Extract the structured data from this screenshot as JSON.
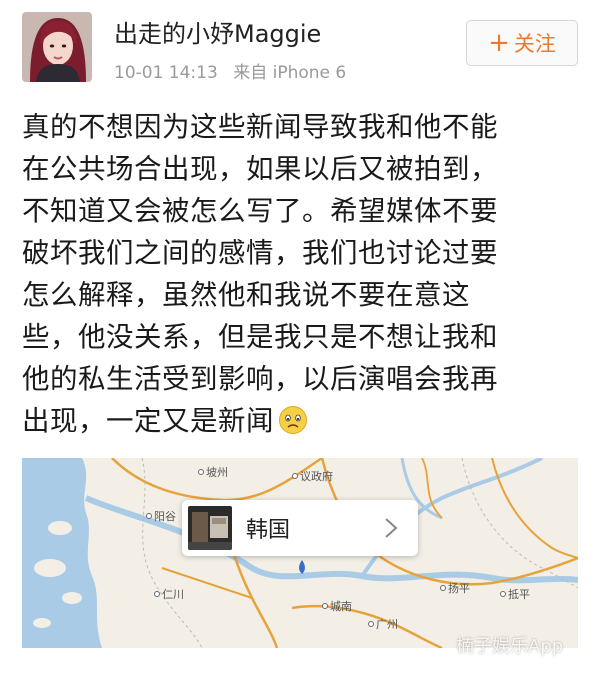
{
  "user": {
    "name": "出走的小妤Maggie",
    "time": "10-01 14:13",
    "source": "来自 iPhone 6"
  },
  "follow": {
    "icon": "plus-icon",
    "label": "关注"
  },
  "post": {
    "lines": [
      "真的不想因为这些新闻导致我和他不能",
      "在公共场合出现，如果以后又被拍到，",
      "不知道又会被怎么写了。希望媒体不要",
      "破坏我们之间的感情，我们也讨论过要",
      "怎么解释，虽然他和我说不要在意这",
      "些，他没关系，但是我只是不想让我和",
      "他的私生活受到影响，以后演唱会我再",
      "出现，一定又是新闻"
    ],
    "emoji": "sad-face-icon"
  },
  "map": {
    "labels": {
      "pazhou": "坡州",
      "uijeongbu": "议政府",
      "yanggu": "阳谷",
      "incheon": "仁川",
      "seongnam": "城南",
      "gwangju": "广州",
      "yangping": "扬平",
      "dipping": "抵平"
    },
    "location": {
      "name": "韩国"
    }
  },
  "watermark": "楠子娱乐App",
  "colors": {
    "follow_accent": "#f0782a",
    "meta_gray": "#9a9a9a",
    "map_land": "#f3efe6",
    "map_water": "#a9cbe6",
    "map_road": "#e8a23b"
  }
}
